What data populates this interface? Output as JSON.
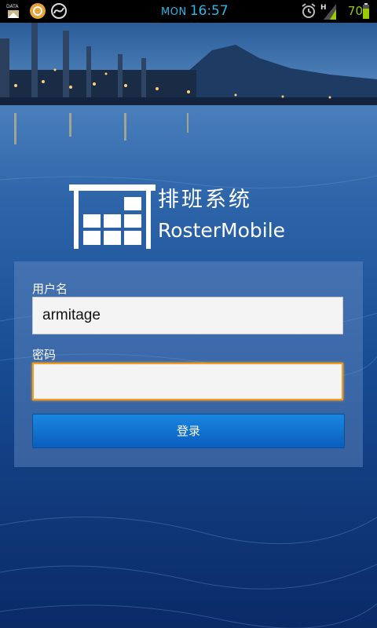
{
  "status_bar": {
    "day": "MON",
    "time": "16:57",
    "battery_level": "70",
    "network_type": "H",
    "data_label": "DATA",
    "icons": [
      "data-sync-icon",
      "browser-app-icon",
      "loop-app-icon",
      "alarm-icon",
      "signal-icon",
      "battery-icon"
    ]
  },
  "logo": {
    "title_cn": "排班系统",
    "title_en": "RosterMobile",
    "icon": "warehouse-shelf-icon"
  },
  "login": {
    "username_label": "用户名",
    "username_value": "armitage",
    "password_label": "密码",
    "password_value": "",
    "submit_label": "登录"
  },
  "colors": {
    "clock": "#33b5e5",
    "battery": "#99cc00",
    "focus_border": "#f39c1f",
    "button": "#0a6fd0"
  }
}
